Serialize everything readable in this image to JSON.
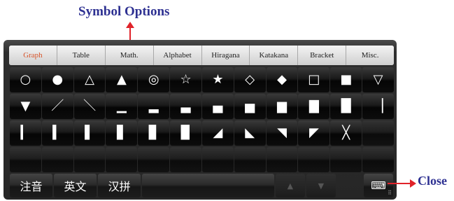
{
  "annotations": {
    "symbol_options": "Symbol Options",
    "close": "Close"
  },
  "tabs": [
    {
      "label": "Graph",
      "active": true
    },
    {
      "label": "Table",
      "active": false
    },
    {
      "label": "Math.",
      "active": false
    },
    {
      "label": "Alphabet",
      "active": false
    },
    {
      "label": "Hiragana",
      "active": false
    },
    {
      "label": "Katakana",
      "active": false
    },
    {
      "label": "Bracket",
      "active": false
    },
    {
      "label": "Misc.",
      "active": false
    }
  ],
  "rows": [
    [
      "○",
      "●",
      "△",
      "▲",
      "◎",
      "☆",
      "★",
      "◇",
      "◆",
      "□",
      "■",
      "▽"
    ],
    [
      "▼",
      "／",
      "＼",
      "▁",
      "▂",
      "▃",
      "▄",
      "▅",
      "▆",
      "▇",
      "█",
      "▕"
    ],
    [
      "▎",
      "▍",
      "▌",
      "▋",
      "▊",
      "▉",
      "◢",
      "◣",
      "◥",
      "◤",
      "╳",
      ""
    ],
    [
      "",
      "",
      "",
      "",
      "",
      "",
      "",
      "",
      "",
      "",
      "",
      ""
    ]
  ],
  "bottom_bar": {
    "lang_keys": [
      "注音",
      "英文",
      "汉拼"
    ],
    "nav_up": "▲",
    "nav_down": "▼",
    "close_icon": "keyboard-close-icon",
    "close_glyph": "⌨"
  },
  "colors": {
    "annotation": "#2e3192",
    "arrow": "#e0232a",
    "active_tab": "#d8542a"
  }
}
